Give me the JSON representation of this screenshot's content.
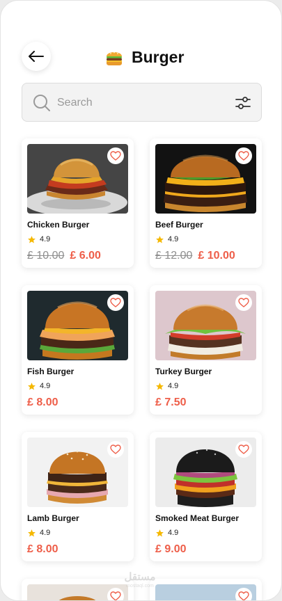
{
  "header": {
    "title": "Burger",
    "title_icon": "burger-emoji-icon",
    "back_icon": "arrow-left-icon"
  },
  "search": {
    "placeholder": "Search",
    "value": "",
    "icon": "search-icon",
    "filter_icon": "sliders-icon"
  },
  "products": [
    {
      "name": "Chicken Burger",
      "rating": "4.9",
      "old_price": "£ 10.00",
      "price": "£ 6.00"
    },
    {
      "name": "Beef Burger",
      "rating": "4.9",
      "old_price": "£ 12.00",
      "price": "£ 10.00"
    },
    {
      "name": "Fish Burger",
      "rating": "4.9",
      "old_price": "",
      "price": "£ 8.00"
    },
    {
      "name": "Turkey Burger",
      "rating": "4.9",
      "old_price": "",
      "price": "£ 7.50"
    },
    {
      "name": "Lamb Burger",
      "rating": "4.9",
      "old_price": "",
      "price": "£ 8.00"
    },
    {
      "name": "Smoked Meat Burger",
      "rating": "4.9",
      "old_price": "",
      "price": "£ 9.00"
    }
  ],
  "colors": {
    "accent": "#ee5e49",
    "star": "#f5b800",
    "muted": "#8e8e8e"
  },
  "watermark": {
    "arabic": "مستقل",
    "latin": "mostaql.com"
  }
}
